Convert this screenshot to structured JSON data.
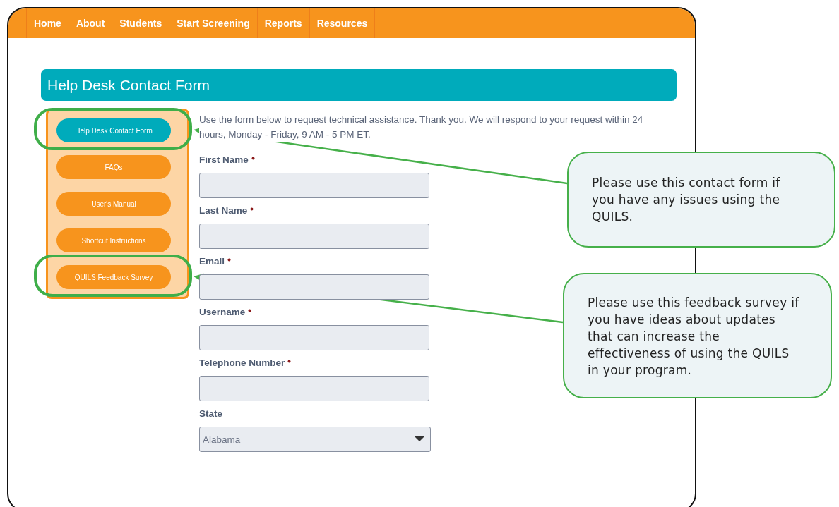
{
  "nav": [
    {
      "label": "Home"
    },
    {
      "label": "About"
    },
    {
      "label": "Students"
    },
    {
      "label": "Start Screening"
    },
    {
      "label": "Reports"
    },
    {
      "label": "Resources"
    }
  ],
  "page_title": "Help Desk Contact Form",
  "sidebar": {
    "items": [
      {
        "label": "Help Desk Contact Form",
        "selected": true,
        "highlighted": true
      },
      {
        "label": "FAQs",
        "selected": false,
        "highlighted": false
      },
      {
        "label": "User's Manual",
        "selected": false,
        "highlighted": false
      },
      {
        "label": "Shortcut Instructions",
        "selected": false,
        "highlighted": false
      },
      {
        "label": "QUILS Feedback Survey",
        "selected": false,
        "highlighted": true
      }
    ]
  },
  "intro": "Use the form below to request technical assistance. Thank you. We will respond to your request within 24 hours, Monday - Friday, 9 AM - 5 PM ET.",
  "fields": [
    {
      "label": "First Name",
      "required": true,
      "kind": "text"
    },
    {
      "label": "Last Name",
      "required": true,
      "kind": "text"
    },
    {
      "label": "Email",
      "required": true,
      "kind": "text"
    },
    {
      "label": "Username",
      "required": true,
      "kind": "text"
    },
    {
      "label": "Telephone Number",
      "required": true,
      "kind": "text"
    },
    {
      "label": "State",
      "required": false,
      "kind": "select",
      "value": "Alabama"
    }
  ],
  "callouts": [
    {
      "text": "Please use this contact form if you have any issues using the QUILS."
    },
    {
      "text": "Please use this feedback survey if you have ideas about updates that can increase the effectiveness of using the QUILS in your program."
    }
  ]
}
